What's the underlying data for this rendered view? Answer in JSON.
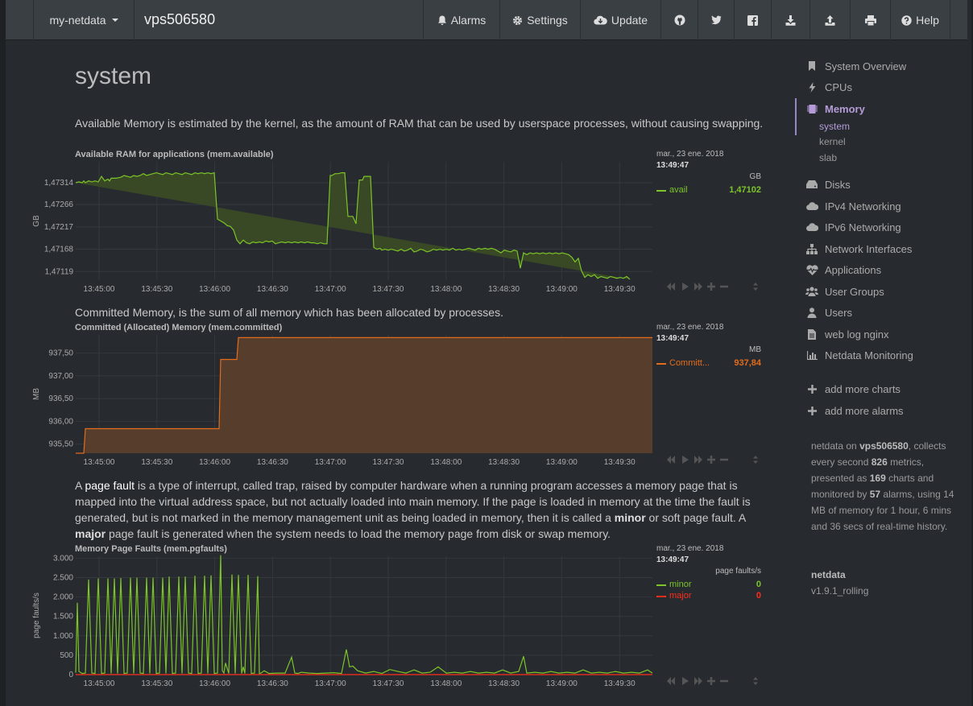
{
  "navbar": {
    "brand": "my-netdata",
    "hostname": "vps506580",
    "items": [
      {
        "label": "Alarms",
        "icon": "bell-icon"
      },
      {
        "label": "Settings",
        "icon": "gear-icon"
      },
      {
        "label": "Update",
        "icon": "cloud-download-icon"
      },
      {
        "label": "",
        "icon": "github-icon"
      },
      {
        "label": "",
        "icon": "twitter-icon"
      },
      {
        "label": "",
        "icon": "facebook-icon"
      },
      {
        "label": "",
        "icon": "download-icon"
      },
      {
        "label": "",
        "icon": "upload-icon"
      },
      {
        "label": "",
        "icon": "print-icon"
      },
      {
        "label": "Help",
        "icon": "question-circle-icon"
      }
    ]
  },
  "section": {
    "title": "system",
    "desc_available": "Available Memory is estimated by the kernel, as the amount of RAM that can be used by userspace processes, without causing swapping.",
    "desc_committed": "Committed Memory, is the sum of all memory which has been allocated by processes.",
    "desc_pgfaults": {
      "p1": "A ",
      "link": "page fault",
      "p2": " is a type of interrupt, called trap, raised by computer hardware when a running program accesses a memory page that is mapped into the virtual address space, but not actually loaded into main memory. If the page is loaded in memory at the time the fault is generated, but is not marked in the memory management unit as being loaded in memory, then it is called a ",
      "minor": "minor",
      "p3": " or soft page fault. A ",
      "major": "major",
      "p4": " page fault is generated when the system needs to load the memory page from disk or swap memory."
    }
  },
  "charts": [
    {
      "title": "Available RAM for applications (mem.available)",
      "ylabel": "GB",
      "unit": "GB",
      "date": "mar., 23 ene. 2018",
      "time": "13:49:47",
      "yticks": [
        "1,47314",
        "1,47266",
        "1,47217",
        "1,47168",
        "1,47119"
      ],
      "xticks": [
        "13:45:00",
        "13:45:30",
        "13:46:00",
        "13:46:30",
        "13:47:00",
        "13:47:30",
        "13:48:00",
        "13:48:30",
        "13:49:00",
        "13:49:30"
      ],
      "series": [
        {
          "name": "avail",
          "value": "1,47102",
          "color": "#7cc427"
        }
      ]
    },
    {
      "title": "Committed (Allocated) Memory (mem.committed)",
      "ylabel": "MB",
      "unit": "MB",
      "date": "mar., 23 ene. 2018",
      "time": "13:49:47",
      "yticks": [
        "937,50",
        "937,00",
        "936,50",
        "936,00",
        "935,50"
      ],
      "xticks": [
        "13:45:00",
        "13:45:30",
        "13:46:00",
        "13:46:30",
        "13:47:00",
        "13:47:30",
        "13:48:00",
        "13:48:30",
        "13:49:00",
        "13:49:30"
      ],
      "series": [
        {
          "name": "Committ...",
          "value": "937,84",
          "color": "#e36b19"
        }
      ]
    },
    {
      "title": "Memory Page Faults (mem.pgfaults)",
      "ylabel": "page faults/s",
      "unit": "page faults/s",
      "date": "mar., 23 ene. 2018",
      "time": "13:49:47",
      "yticks": [
        "3.000",
        "2.500",
        "2.000",
        "1.500",
        "1.000",
        "500",
        "0"
      ],
      "xticks": [
        "13:45:00",
        "13:45:30",
        "13:46:00",
        "13:46:30",
        "13:47:00",
        "13:47:30",
        "13:48:00",
        "13:48:30",
        "13:49:00",
        "13:49:30"
      ],
      "series": [
        {
          "name": "minor",
          "value": "0",
          "color": "#7cc427"
        },
        {
          "name": "major",
          "value": "0",
          "color": "#ff2d1a"
        }
      ]
    }
  ],
  "chart_data": [
    {
      "type": "area",
      "title": "Available RAM for applications (mem.available)",
      "ylabel": "GB",
      "ylim": [
        1.471,
        1.4736
      ],
      "x": [
        0,
        4,
        8,
        10,
        12,
        16,
        20,
        24,
        28,
        30,
        32,
        36,
        40,
        42,
        44,
        50,
        56,
        60,
        64,
        68,
        72,
        76,
        80,
        84,
        86,
        88,
        92,
        96,
        100,
        104,
        108,
        112,
        116,
        120,
        124,
        128,
        132,
        136,
        140,
        144,
        148,
        152,
        156,
        160,
        164,
        168,
        172,
        176,
        180,
        184,
        188,
        192,
        196,
        200,
        204,
        208,
        212,
        216,
        220,
        224,
        228,
        232,
        236,
        240,
        244,
        248,
        252,
        256,
        260,
        264,
        268,
        272,
        276,
        280,
        284,
        288,
        292,
        296,
        300,
        304,
        308,
        312,
        316,
        318,
        322,
        326,
        330,
        334,
        338,
        340,
        344,
        348,
        352,
        356,
        358,
        362,
        366,
        370,
        374,
        378,
        380,
        384,
        388,
        392,
        396,
        400,
        404,
        408,
        412,
        416,
        420,
        424,
        428,
        432,
        436,
        440,
        444,
        448,
        452,
        456,
        460,
        464,
        468,
        472,
        476,
        480,
        484,
        488,
        492,
        496,
        500,
        504,
        508,
        512,
        516,
        520,
        524,
        528,
        532,
        536,
        540,
        544,
        548,
        552,
        556,
        560,
        564,
        568,
        572,
        576,
        580,
        584,
        588,
        592,
        596,
        600,
        604,
        608,
        612,
        616,
        620,
        624,
        628,
        632,
        636,
        640,
        644,
        648,
        652,
        656,
        660,
        664,
        668,
        672,
        676,
        680,
        684,
        688,
        692,
        696,
        700,
        704,
        708,
        712,
        716
      ],
      "series": [
        {
          "name": "avail",
          "values": [
            1.47314,
            1.47316,
            1.47314,
            1.47318,
            1.47314,
            1.47318,
            1.47316,
            1.47318,
            1.47316,
            1.47322,
            1.47328,
            1.47318,
            1.47322,
            1.47318,
            1.47324,
            1.47324,
            1.47326,
            1.4733,
            1.47328,
            1.47326,
            1.4733,
            1.47328,
            1.4733,
            1.47334,
            1.47332,
            1.4733,
            1.47332,
            1.47334,
            1.47336,
            1.47334,
            1.47332,
            1.47336,
            1.47334,
            1.47332,
            1.47336,
            1.47334,
            1.47332,
            1.47336,
            1.47334,
            1.47332,
            1.47336,
            1.47334,
            1.47336,
            1.47334,
            1.47336,
            1.47334,
            1.47336,
            1.47234,
            1.4723,
            1.47226,
            1.4722,
            1.47218,
            1.4721,
            1.47188,
            1.4718,
            1.47188,
            1.47182,
            1.4718,
            1.47184,
            1.47182,
            1.47184,
            1.47182,
            1.47186,
            1.47184,
            1.47186,
            1.4718,
            1.47182,
            1.47184,
            1.47182,
            1.47184,
            1.47182,
            1.47184,
            1.47182,
            1.47184,
            1.47182,
            1.47184,
            1.47182,
            1.47182,
            1.4718,
            1.47182,
            1.4718,
            1.4718,
            1.4733,
            1.4733,
            1.47334,
            1.47334,
            1.47336,
            1.47336,
            1.4724,
            1.4724,
            1.4724,
            1.47224,
            1.4732,
            1.4732,
            1.47328,
            1.47328,
            1.47328,
            1.47172,
            1.47168,
            1.4717,
            1.47166,
            1.47168,
            1.47166,
            1.47168,
            1.47166,
            1.47164,
            1.47168,
            1.47164,
            1.47166,
            1.4717,
            1.47162,
            1.47164,
            1.47168,
            1.47166,
            1.47162,
            1.47164,
            1.47168,
            1.47166,
            1.47168,
            1.47166,
            1.47168,
            1.47166,
            1.4717,
            1.47166,
            1.47168,
            1.47166,
            1.47168,
            1.4717,
            1.47168,
            1.47166,
            1.4717,
            1.47168,
            1.4717,
            1.47168,
            1.4717,
            1.47168,
            1.47164,
            1.4716,
            1.47166,
            1.47164,
            1.47162,
            1.47166,
            1.47164,
            1.47126,
            1.4716,
            1.47156,
            1.4716,
            1.47158,
            1.4716,
            1.47158,
            1.4716,
            1.47158,
            1.4716,
            1.47158,
            1.4716,
            1.47158,
            1.4716,
            1.47158,
            1.47156,
            1.4715,
            1.4714,
            1.47148,
            1.4712,
            1.47106,
            1.47112,
            1.47108,
            1.47112,
            1.47104,
            1.47108,
            1.47106,
            1.47104,
            1.47108,
            1.47106,
            1.47104,
            1.47106,
            1.47104,
            1.47108,
            1.47102
          ]
        }
      ]
    },
    {
      "type": "area",
      "title": "Committed (Allocated) Memory (mem.committed)",
      "ylabel": "MB",
      "ylim": [
        935.3,
        937.9
      ],
      "x": [
        0,
        10,
        12,
        178,
        180,
        200,
        202,
        716
      ],
      "series": [
        {
          "name": "Committ...",
          "values": [
            935.3,
            935.3,
            935.84,
            935.84,
            937.36,
            937.36,
            937.84,
            937.84
          ]
        }
      ]
    },
    {
      "type": "line",
      "title": "Memory Page Faults (mem.pgfaults)",
      "ylabel": "page faults/s",
      "ylim": [
        0,
        3050
      ],
      "x": [
        0,
        2,
        4,
        8,
        12,
        16,
        20,
        24,
        28,
        32,
        36,
        40,
        44,
        48,
        52,
        56,
        60,
        64,
        68,
        72,
        76,
        80,
        84,
        88,
        92,
        96,
        100,
        104,
        108,
        112,
        116,
        120,
        124,
        128,
        132,
        136,
        140,
        144,
        148,
        152,
        156,
        160,
        164,
        168,
        172,
        176,
        180,
        182,
        184,
        186,
        190,
        194,
        198,
        202,
        206,
        208,
        210,
        214,
        218,
        222,
        226,
        228,
        230,
        234,
        240,
        250,
        260,
        268,
        272,
        276,
        280,
        290,
        300,
        310,
        320,
        330,
        336,
        340,
        344,
        350,
        360,
        370,
        380,
        390,
        400,
        410,
        420,
        430,
        440,
        450,
        460,
        470,
        480,
        490,
        500,
        510,
        520,
        530,
        540,
        550,
        556,
        560,
        570,
        580,
        590,
        600,
        610,
        620,
        630,
        640,
        650,
        660,
        670,
        680,
        690,
        700,
        710,
        716
      ],
      "series": [
        {
          "name": "minor",
          "values": [
            50,
            1850,
            80,
            30,
            40,
            2450,
            40,
            30,
            2480,
            30,
            40,
            2480,
            30,
            2480,
            30,
            2490,
            30,
            40,
            2500,
            30,
            2500,
            40,
            30,
            2500,
            30,
            2500,
            30,
            40,
            2500,
            30,
            2530,
            30,
            40,
            2530,
            30,
            2530,
            40,
            30,
            2550,
            30,
            40,
            2550,
            30,
            2560,
            30,
            40,
            3080,
            100,
            40,
            300,
            30,
            2580,
            30,
            2570,
            30,
            200,
            30,
            2570,
            30,
            40,
            2540,
            30,
            40,
            100,
            30,
            40,
            40,
            450,
            40,
            30,
            60,
            40,
            30,
            40,
            50,
            30,
            650,
            200,
            220,
            100,
            40,
            80,
            30,
            130,
            80,
            40,
            120,
            40,
            60,
            200,
            40,
            60,
            40,
            80,
            40,
            60,
            40,
            120,
            40,
            80,
            470,
            40,
            60,
            40,
            80,
            40,
            60,
            40,
            120,
            40,
            60,
            40,
            80,
            40,
            60,
            40,
            120,
            40
          ]
        },
        {
          "name": "major",
          "values": [
            0,
            0,
            0,
            0,
            0,
            0,
            0,
            0,
            0,
            0,
            0,
            0,
            0,
            0,
            0,
            0,
            0,
            0,
            0,
            0,
            0,
            0,
            0,
            0,
            0,
            0,
            0,
            0,
            0,
            0,
            0,
            0,
            0,
            0,
            0,
            0,
            0,
            0,
            0,
            0,
            0,
            0,
            0,
            0,
            0,
            0,
            0,
            0,
            0,
            0,
            0,
            0,
            0,
            0,
            0,
            0,
            0,
            0,
            0,
            0,
            0,
            0,
            0,
            0,
            0,
            0,
            0,
            0,
            0,
            0,
            0,
            0,
            0,
            0,
            0,
            0,
            0,
            0,
            0,
            0,
            0,
            0,
            0,
            0,
            0,
            0,
            0,
            0,
            0,
            0,
            0,
            0,
            0,
            0,
            0,
            0,
            0,
            0,
            0,
            0,
            0,
            0,
            0,
            0,
            0,
            0,
            0,
            0,
            0,
            0,
            0,
            0,
            0,
            0,
            0,
            0,
            0,
            0
          ]
        }
      ]
    }
  ],
  "sidebar": {
    "items": [
      {
        "label": "System Overview",
        "icon": "bookmark-icon"
      },
      {
        "label": "CPUs",
        "icon": "bolt-icon"
      },
      {
        "label": "Memory",
        "icon": "microchip-icon"
      },
      {
        "label": "Disks",
        "icon": "hdd-icon"
      },
      {
        "label": "IPv4 Networking",
        "icon": "cloud-icon"
      },
      {
        "label": "IPv6 Networking",
        "icon": "cloud-icon"
      },
      {
        "label": "Network Interfaces",
        "icon": "sitemap-icon"
      },
      {
        "label": "Applications",
        "icon": "heartbeat-icon"
      },
      {
        "label": "User Groups",
        "icon": "users-icon"
      },
      {
        "label": "Users",
        "icon": "user-icon"
      },
      {
        "label": "web log nginx",
        "icon": "file-icon"
      },
      {
        "label": "Netdata Monitoring",
        "icon": "bar-chart-icon"
      }
    ],
    "subitems": [
      "system",
      "kernel",
      "slab"
    ],
    "add_charts": "add more charts",
    "add_alarms": "add more alarms",
    "info": {
      "t1": "netdata on ",
      "host": "vps506580",
      "t2": ", collects every second ",
      "metrics": "826",
      "t3": " metrics, presented as ",
      "charts": "169",
      "t4": " charts and monitored by ",
      "alarms": "57",
      "t5": " alarms, using 14 MB of memory for 1 hour, 6 mins and 36 secs of real-time history."
    },
    "version_title": "netdata",
    "version": "v1.9.1_rolling"
  }
}
